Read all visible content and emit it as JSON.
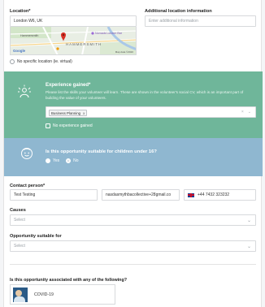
{
  "location": {
    "label": "Location*",
    "value": "London W6, UK",
    "map_labels": {
      "place1": "Hammersmith",
      "place2": "Nomads London Bar",
      "area": "HAMMERSMITH",
      "google": "Google",
      "credit": "Map data ©2020"
    },
    "no_specific_label": "No specific location (ie. virtual)"
  },
  "additional_location": {
    "label": "Additional location information",
    "placeholder": "Enter additional information"
  },
  "experience": {
    "title": "Experience gained*",
    "description": "Please list the skills your volunteer will learn. These are shown in the volunteer's social CV, which is an important part of building the value of your volunteers.",
    "chip": "Business Planning",
    "chip_remove": "x",
    "clear_symbol": "×",
    "dropdown_symbol": "⌄",
    "none_label": "No experience gained"
  },
  "children": {
    "question": "Is this opportunity suitable for children under 16?",
    "yes": "Yes",
    "no": "No"
  },
  "contact": {
    "label": "Contact person*",
    "name": "Test Testing",
    "email": "nasdasmythbacollective+28gmail.co",
    "phone": "+44 7432 323232"
  },
  "causes": {
    "label": "Causes",
    "placeholder": "Select"
  },
  "opportunity_for": {
    "label": "Opportunity suitable for",
    "placeholder": "Select"
  },
  "associated": {
    "question": "Is this opportunity associated with any of the following?",
    "item": "COVID-19"
  },
  "colors": {
    "experience_bg": "#6fb69a",
    "children_bg": "#8fb7d0",
    "map_marker": "#d93025"
  }
}
